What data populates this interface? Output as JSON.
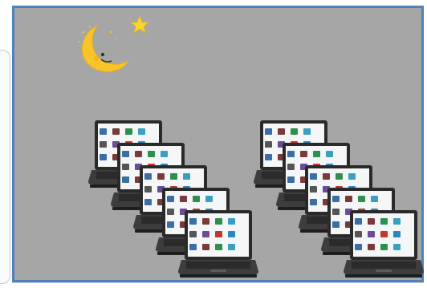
{
  "scene": {
    "background_color": "#a6a6a6",
    "frame_color": "#4f81bd",
    "moon_icon": "crescent-moon-with-star-icon",
    "laptop_icon": "laptop-icon",
    "left_stack_count": 5,
    "right_stack_count": 5
  }
}
